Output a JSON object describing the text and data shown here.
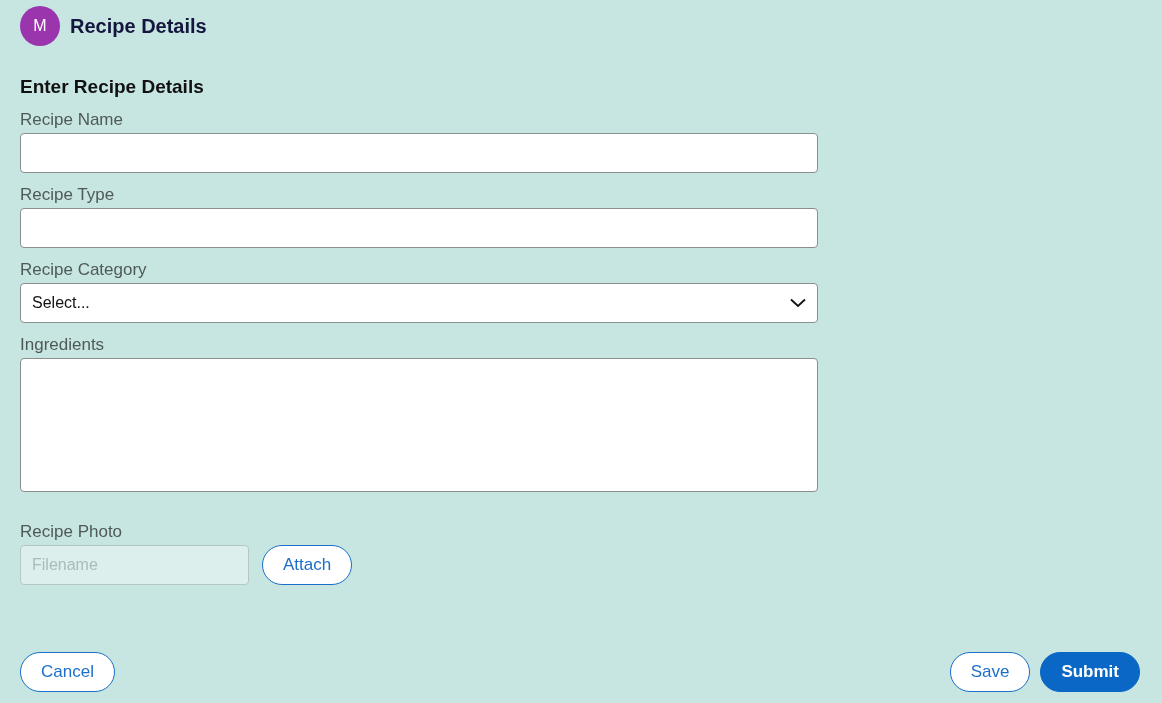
{
  "header": {
    "avatar": "M",
    "title": "Recipe Details"
  },
  "form": {
    "heading": "Enter Recipe Details",
    "fields": [
      {
        "kind": "text",
        "label": "Recipe Name"
      },
      {
        "kind": "text",
        "label": "Recipe Type"
      },
      {
        "kind": "select",
        "label": "Recipe Category",
        "value": "Select..."
      },
      {
        "kind": "textarea",
        "label": "Ingredients"
      },
      {
        "kind": "file",
        "label": "Recipe Photo",
        "placeholder": "Filename",
        "disabled": true,
        "button": "Attach"
      }
    ]
  },
  "actions": {
    "left": [
      {
        "label": "Cancel",
        "kind": "secondary"
      }
    ],
    "right": [
      {
        "label": "Save",
        "kind": "secondary"
      },
      {
        "label": "Submit",
        "kind": "primary"
      }
    ]
  }
}
